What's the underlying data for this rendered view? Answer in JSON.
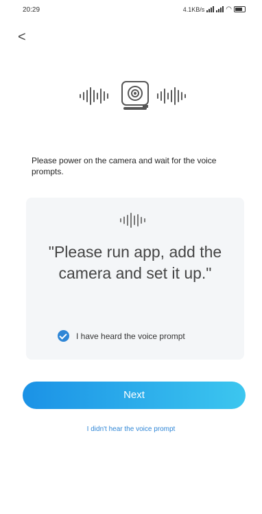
{
  "status_bar": {
    "time": "20:29",
    "network_speed": "4.1KB/s",
    "signal_icon": "signal-icon",
    "wifi_icon": "wifi-icon",
    "battery_icon": "battery-icon"
  },
  "nav": {
    "back_icon": "back-chevron-icon",
    "back_glyph": "<"
  },
  "hero": {
    "icon": "camera-icon",
    "wave_icon": "sound-wave-icon"
  },
  "instruction": "Please power on the camera and wait for the voice prompts.",
  "prompt_card": {
    "wave_icon": "sound-wave-icon",
    "quote": "\"Please run app, add the camera and set it up.\"",
    "checkbox_checked": true,
    "checkbox_label": "I have heard the voice prompt"
  },
  "actions": {
    "next_label": "Next",
    "no_prompt_link": "I didn't hear the voice prompt"
  },
  "colors": {
    "accent": "#2f86d6",
    "button_gradient_start": "#1b92e6",
    "button_gradient_end": "#3cc6ef",
    "card_background": "#f4f6f8"
  }
}
